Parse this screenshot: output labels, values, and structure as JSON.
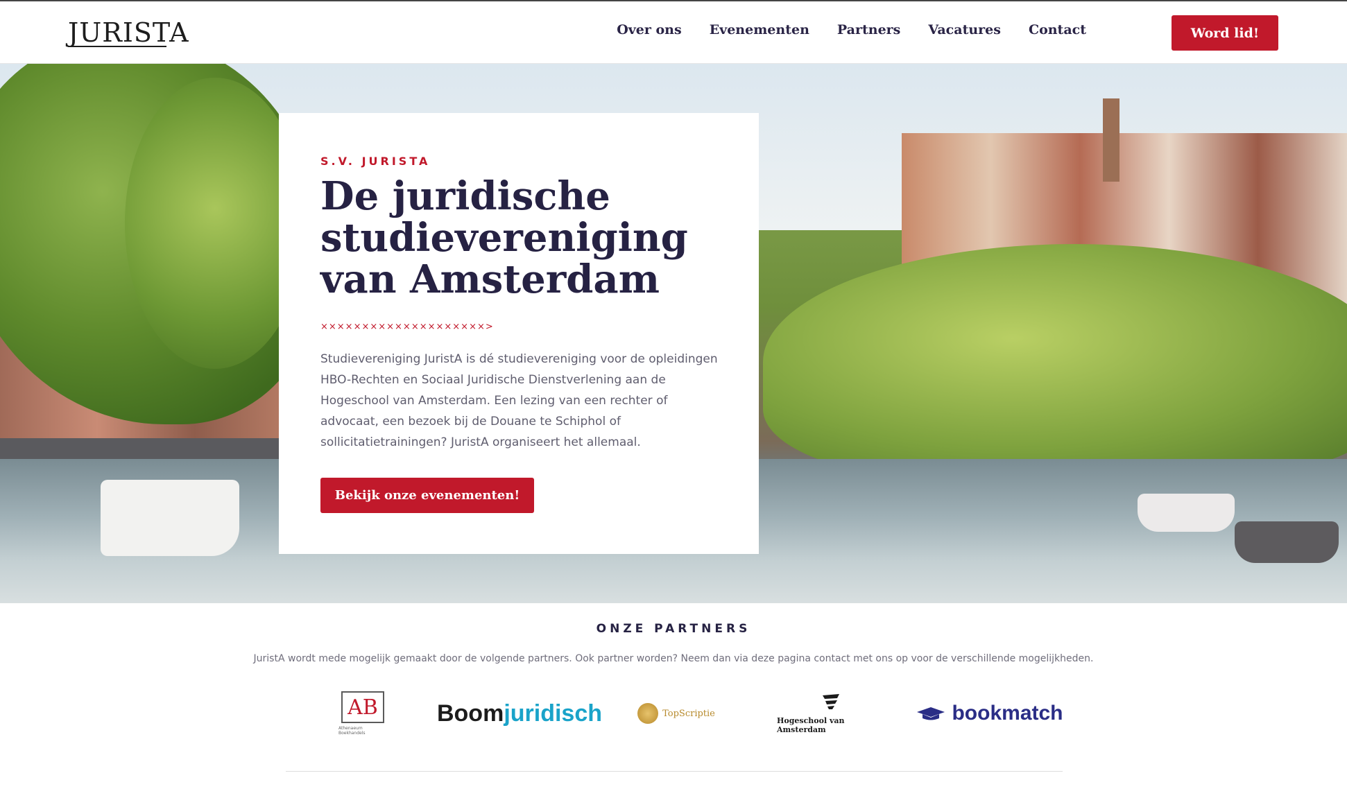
{
  "header": {
    "logo": "JURISTA",
    "nav": [
      "Over ons",
      "Evenementen",
      "Partners",
      "Vacatures",
      "Contact"
    ],
    "join_button": "Word lid!"
  },
  "hero": {
    "eyebrow": "S.V. JURISTA",
    "title": "De juridische studievereniging van Amsterdam",
    "divider": "××××××××××××××××××××>",
    "description": "Studievereniging JuristA is dé studievereniging voor de opleidingen HBO-Rechten en Sociaal Juridische Dienstverlening aan de Hogeschool van Amsterdam. Een lezing van een rechter of advocaat, een bezoek bij de Douane te Schiphol of sollicitatietrainingen? JuristA organiseert het allemaal.",
    "cta": "Bekijk onze evenementen!"
  },
  "partners": {
    "heading": "ONZE PARTNERS",
    "subtitle": "JuristA wordt mede mogelijk gemaakt door de volgende partners. Ook partner worden? Neem dan via deze pagina contact met ons op voor de verschillende mogelijkheden.",
    "logos": {
      "ab": "AB",
      "ab_caption": "Athenaeum Boekhandels",
      "boom_a": "Boom",
      "boom_b": "juridisch",
      "topscriptie": "TopScriptie",
      "hva": "Hogeschool van Amsterdam",
      "bookmatch": "bookmatch"
    }
  },
  "colors": {
    "accent": "#c1192b",
    "heading": "#262243",
    "body_text": "#5f5d6e"
  }
}
